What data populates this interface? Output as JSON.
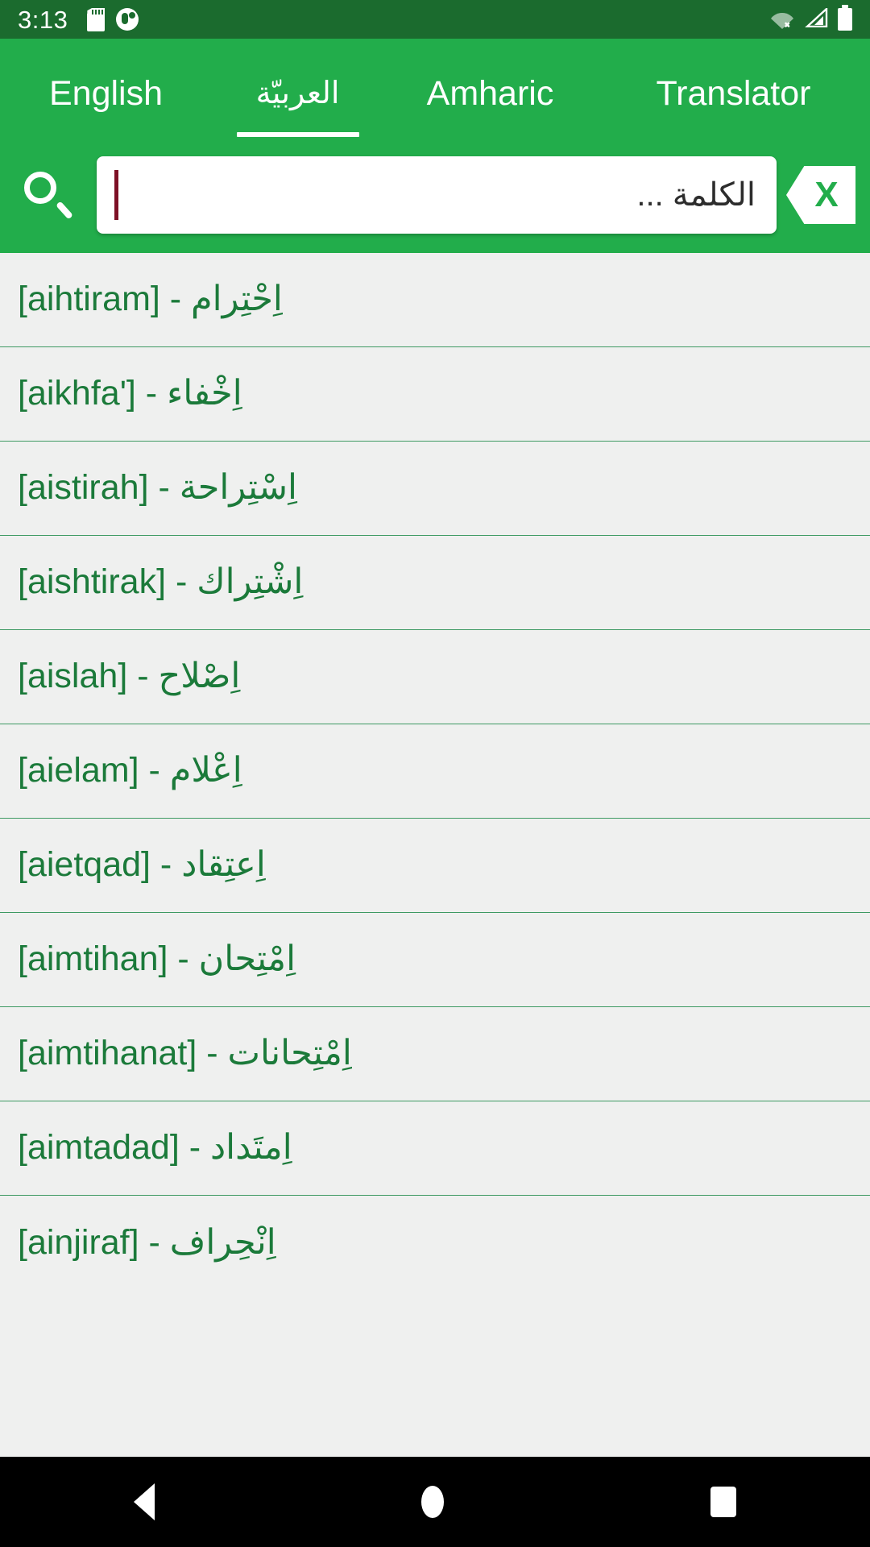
{
  "status_bar": {
    "time": "3:13",
    "left_icons": [
      "sd-card-icon",
      "app-notification-icon"
    ],
    "right_icons": [
      "wifi-off-icon",
      "cellular-signal-icon",
      "battery-icon"
    ],
    "background_color": "#1b6b2e"
  },
  "app_bar": {
    "background_color": "#22ad4b",
    "tabs": [
      {
        "label": "English",
        "active": false
      },
      {
        "label": "العربيّة",
        "active": true
      },
      {
        "label": "Amharic",
        "active": false
      },
      {
        "label": "Translator",
        "active": false
      }
    ],
    "search": {
      "icon": "search-icon",
      "value": "",
      "placeholder": "الكلمة ...",
      "clear_label": "X"
    }
  },
  "word_list": {
    "background_color": "#eff0ef",
    "text_color": "#1b7a3a",
    "separator_color": "#3e9a63",
    "items": [
      {
        "text": "اِحْتِرام - [aihtiram]"
      },
      {
        "text": "اِخْفاء - ['aikhfa]"
      },
      {
        "text": "اِسْتِراحة - [aistirah]"
      },
      {
        "text": "اِشْتِراك - [aishtirak]"
      },
      {
        "text": "اِصْلاح - [aislah]"
      },
      {
        "text": "اِعْلام - [aielam]"
      },
      {
        "text": "اِعتِقاد - [aietqad]"
      },
      {
        "text": "اِمْتِحان - [aimtihan]"
      },
      {
        "text": "اِمْتِحانات - [aimtihanat]"
      },
      {
        "text": "اِمتَداد - [aimtadad]"
      },
      {
        "text": "اِنْحِراف - [ainjiraf]"
      }
    ]
  },
  "nav_bar": {
    "background_color": "#000000",
    "buttons": [
      "back-button",
      "home-button",
      "recents-button"
    ]
  }
}
